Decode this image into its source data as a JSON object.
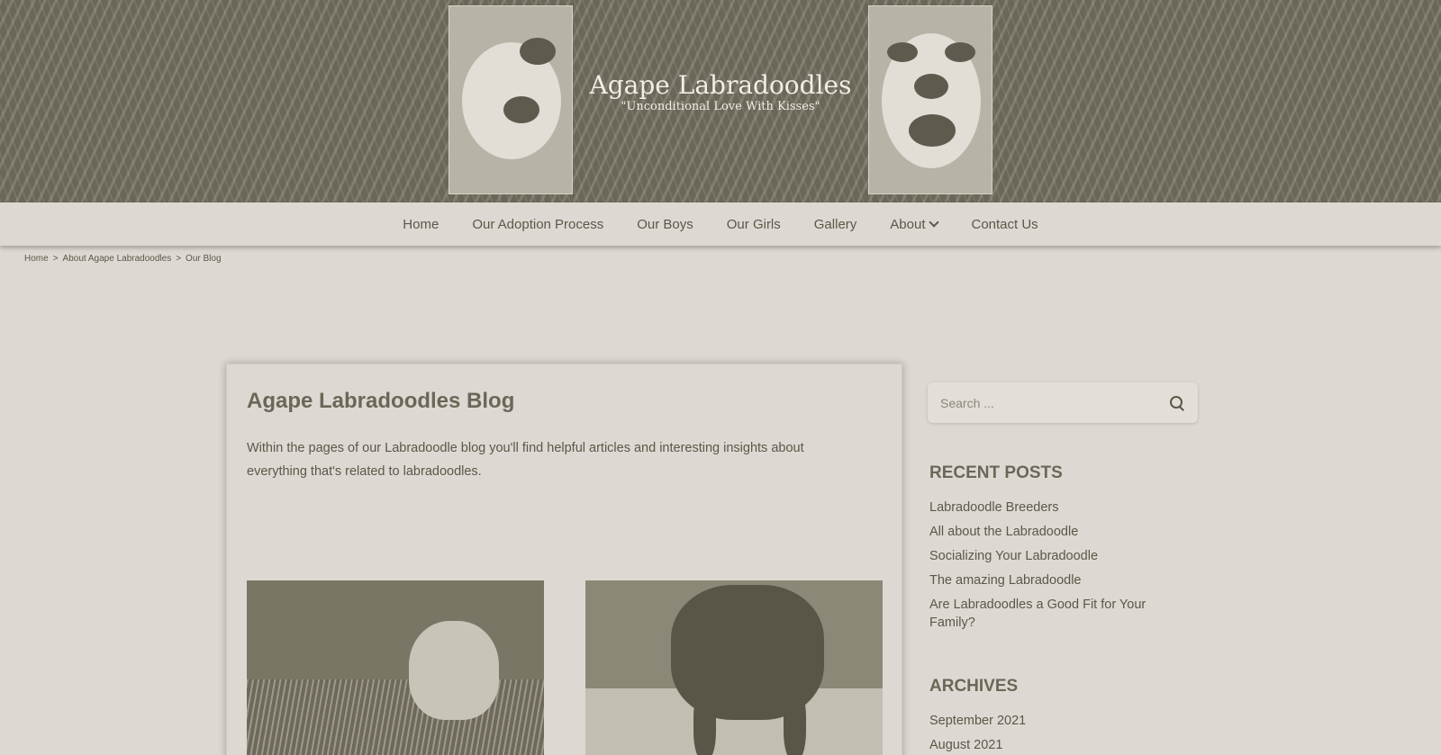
{
  "header": {
    "site_title": "Agape Labradoodles",
    "tagline": "\"Unconditional Love With Kisses\""
  },
  "nav": {
    "items": [
      {
        "label": "Home"
      },
      {
        "label": "Our Adoption Process"
      },
      {
        "label": "Our Boys"
      },
      {
        "label": "Our Girls"
      },
      {
        "label": "Gallery"
      },
      {
        "label": "About",
        "has_dropdown": true
      },
      {
        "label": "Contact Us"
      }
    ]
  },
  "breadcrumb": {
    "items": [
      "Home",
      "About Agape Labradoodles",
      "Our Blog"
    ],
    "separator": ">"
  },
  "main": {
    "title": "Agape Labradoodles Blog",
    "intro": "Within the pages of our Labradoodle blog you'll find helpful articles and interesting insights about everything that's related to labradoodles."
  },
  "sidebar": {
    "search": {
      "placeholder": "Search ..."
    },
    "recent_posts": {
      "title": "RECENT POSTS",
      "items": [
        "Labradoodle Breeders",
        "All about the Labradoodle",
        "Socializing Your Labradoodle",
        "The amazing Labradoodle",
        "Are Labradoodles a Good Fit for Your Family?"
      ]
    },
    "archives": {
      "title": "ARCHIVES",
      "items": [
        "September 2021",
        "August 2021"
      ]
    }
  },
  "colors": {
    "dark": "#6b6758",
    "light": "#ddd9d2"
  }
}
